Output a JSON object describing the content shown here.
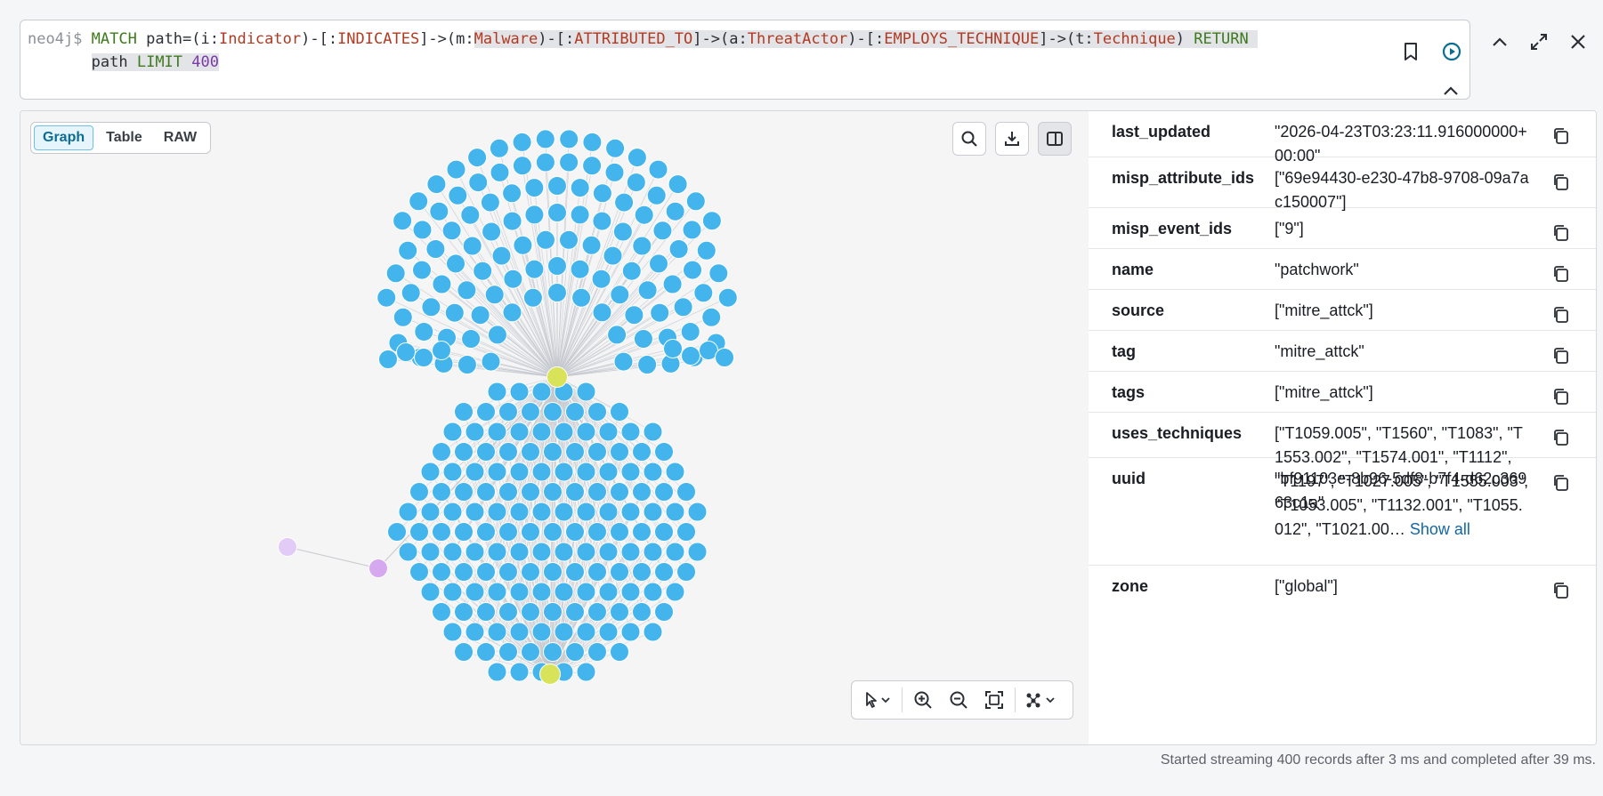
{
  "editor": {
    "prompt": "neo4j$",
    "query": {
      "match_kw": "MATCH",
      "path_assign": " path=(i:",
      "label_indicator": "Indicator",
      "rel_open_1": ")-[:",
      "rel_indicates": "INDICATES",
      "rel_close_1": "]->(m:",
      "label_malware": "Malware",
      "rel_open_2": ")-[:",
      "rel_attributed": "ATTRIBUTED_TO",
      "rel_close_2": "]->(a:",
      "label_actor": "ThreatActor",
      "rel_open_3": ")-[:",
      "rel_employs": "EMPLOYS_TECHNIQUE",
      "rel_close_3": "]->(t:",
      "label_technique": "Technique",
      "close_paren": ") ",
      "return_kw": "RETURN",
      "path_word": "path ",
      "limit_kw": "LIMIT",
      "limit_value": "400"
    }
  },
  "view_tabs": [
    {
      "label": "Graph",
      "active": true
    },
    {
      "label": "Table",
      "active": false
    },
    {
      "label": "RAW",
      "active": false
    }
  ],
  "icons": {
    "bookmark": "bookmark-icon",
    "run": "run-icon",
    "collapse": "chevron-up-icon",
    "expand": "expand-icon",
    "close": "close-icon",
    "search": "search-icon",
    "download": "download-icon",
    "panel": "panel-toggle-icon",
    "select": "pointer-icon",
    "zoom_in": "zoom-in-icon",
    "zoom_out": "zoom-out-icon",
    "fit": "fit-screen-icon",
    "layout": "layout-icon",
    "copy": "copy-icon"
  },
  "colors": {
    "technique_node": "#43b5ec",
    "threat_actor_node": "#d8e35a",
    "malware_node": "#d6a8f0",
    "indicator_node": "#e2cbf7",
    "edge": "#c2c6cc"
  },
  "properties": [
    {
      "key": "last_updated",
      "value": "\"2026-04-23T03:23:11.916000000+00:00\""
    },
    {
      "key": "misp_attribute_ids",
      "value": "[\"69e94430-e230-47b8-9708-09a7ac150007\"]"
    },
    {
      "key": "misp_event_ids",
      "value": "[\"9\"]"
    },
    {
      "key": "name",
      "value": "\"patchwork\""
    },
    {
      "key": "source",
      "value": "[\"mitre_attck\"]"
    },
    {
      "key": "tag",
      "value": "\"mitre_attck\""
    },
    {
      "key": "tags",
      "value": "[\"mitre_attck\"]"
    },
    {
      "key": "uses_techniques",
      "value": "[\"T1059.005\", \"T1560\", \"T1083\", \"T1553.002\", \"T1574.001\", \"T1112\", \"T1197\", \"T1027.005\", \"T1555.003\", \"T1053.005\", \"T1132.001\", \"T1055.012\", \"T1021.00…",
      "link": "Show all"
    },
    {
      "key": "uuid",
      "value": "\"bf91103e-8b96-5df8-b7f4-d62c36963c1a\""
    },
    {
      "key": "zone",
      "value": "[\"global\"]"
    }
  ],
  "status_text": "Started streaming 400 records after 3 ms and completed after 39 ms."
}
